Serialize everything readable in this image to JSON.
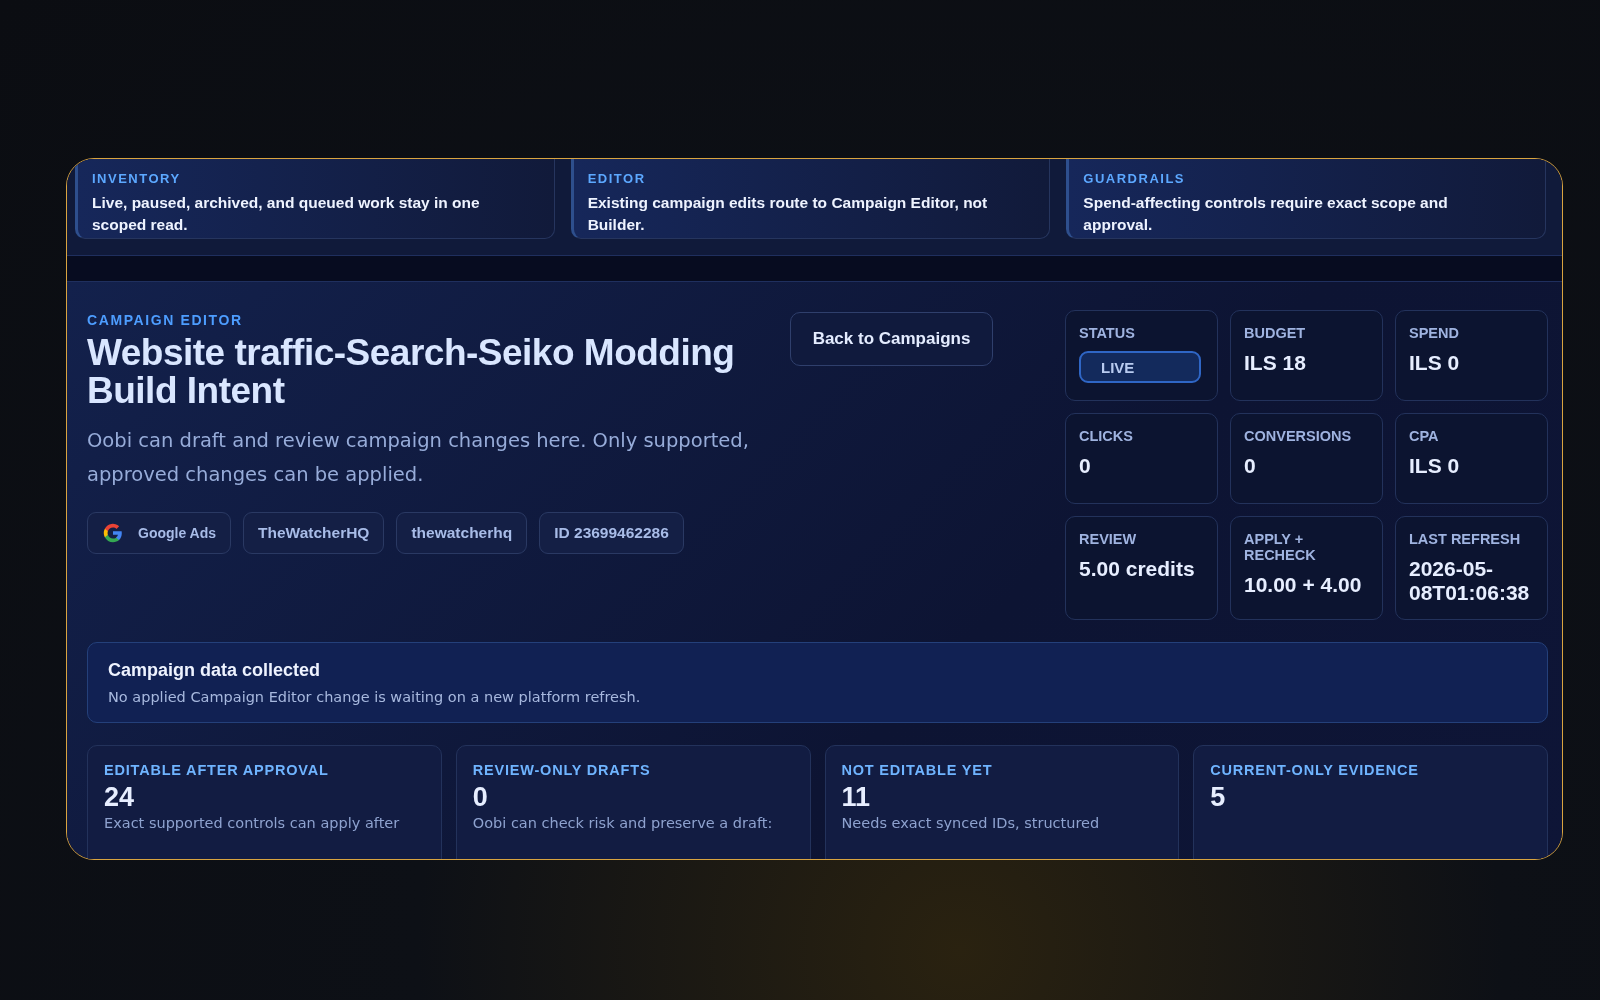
{
  "notes": [
    {
      "label": "INVENTORY",
      "text": "Live, paused, archived, and queued work stay in one scoped read."
    },
    {
      "label": "EDITOR",
      "text": "Existing campaign edits route to Campaign Editor, not Builder."
    },
    {
      "label": "GUARDRAILS",
      "text": "Spend-affecting controls require exact scope and approval."
    }
  ],
  "header": {
    "eyebrow": "CAMPAIGN EDITOR",
    "title": "Website traffic-Search-Seiko Modding Build Intent",
    "description": "Oobi can draft and review campaign changes here. Only supported, approved changes can be applied.",
    "chips": [
      {
        "kind": "platform",
        "label": "Google Ads"
      },
      {
        "kind": "plain",
        "label": "TheWatcherHQ"
      },
      {
        "kind": "plain",
        "label": "thewatcherhq"
      },
      {
        "kind": "plain",
        "label": "ID 23699462286"
      }
    ]
  },
  "back_button": "Back to Campaigns",
  "metrics": [
    {
      "label": "STATUS",
      "kind": "status",
      "value": "LIVE"
    },
    {
      "label": "BUDGET",
      "kind": "value",
      "value": "ILS 18"
    },
    {
      "label": "SPEND",
      "kind": "value",
      "value": "ILS 0"
    },
    {
      "label": "CLICKS",
      "kind": "value",
      "value": "0"
    },
    {
      "label": "CONVERSIONS",
      "kind": "value",
      "value": "0"
    },
    {
      "label": "CPA",
      "kind": "value",
      "value": "ILS 0"
    },
    {
      "label": "REVIEW",
      "kind": "value",
      "value": "5.00 credits"
    },
    {
      "label": "APPLY + RECHECK",
      "kind": "value",
      "value": "10.00 + 4.00"
    },
    {
      "label": "LAST REFRESH",
      "kind": "value",
      "value": "2026-05-08T01:06:38"
    }
  ],
  "notice": {
    "title": "Campaign data collected",
    "text": "No applied Campaign Editor change is waiting on a new platform refresh."
  },
  "summary": [
    {
      "label": "EDITABLE AFTER APPROVAL",
      "count": "24",
      "text": "Exact supported controls can apply after"
    },
    {
      "label": "REVIEW-ONLY DRAFTS",
      "count": "0",
      "text": "Oobi can check risk and preserve a draft:"
    },
    {
      "label": "NOT EDITABLE YET",
      "count": "11",
      "text": "Needs exact synced IDs, structured"
    },
    {
      "label": "CURRENT-ONLY EVIDENCE",
      "count": "5"
    }
  ]
}
